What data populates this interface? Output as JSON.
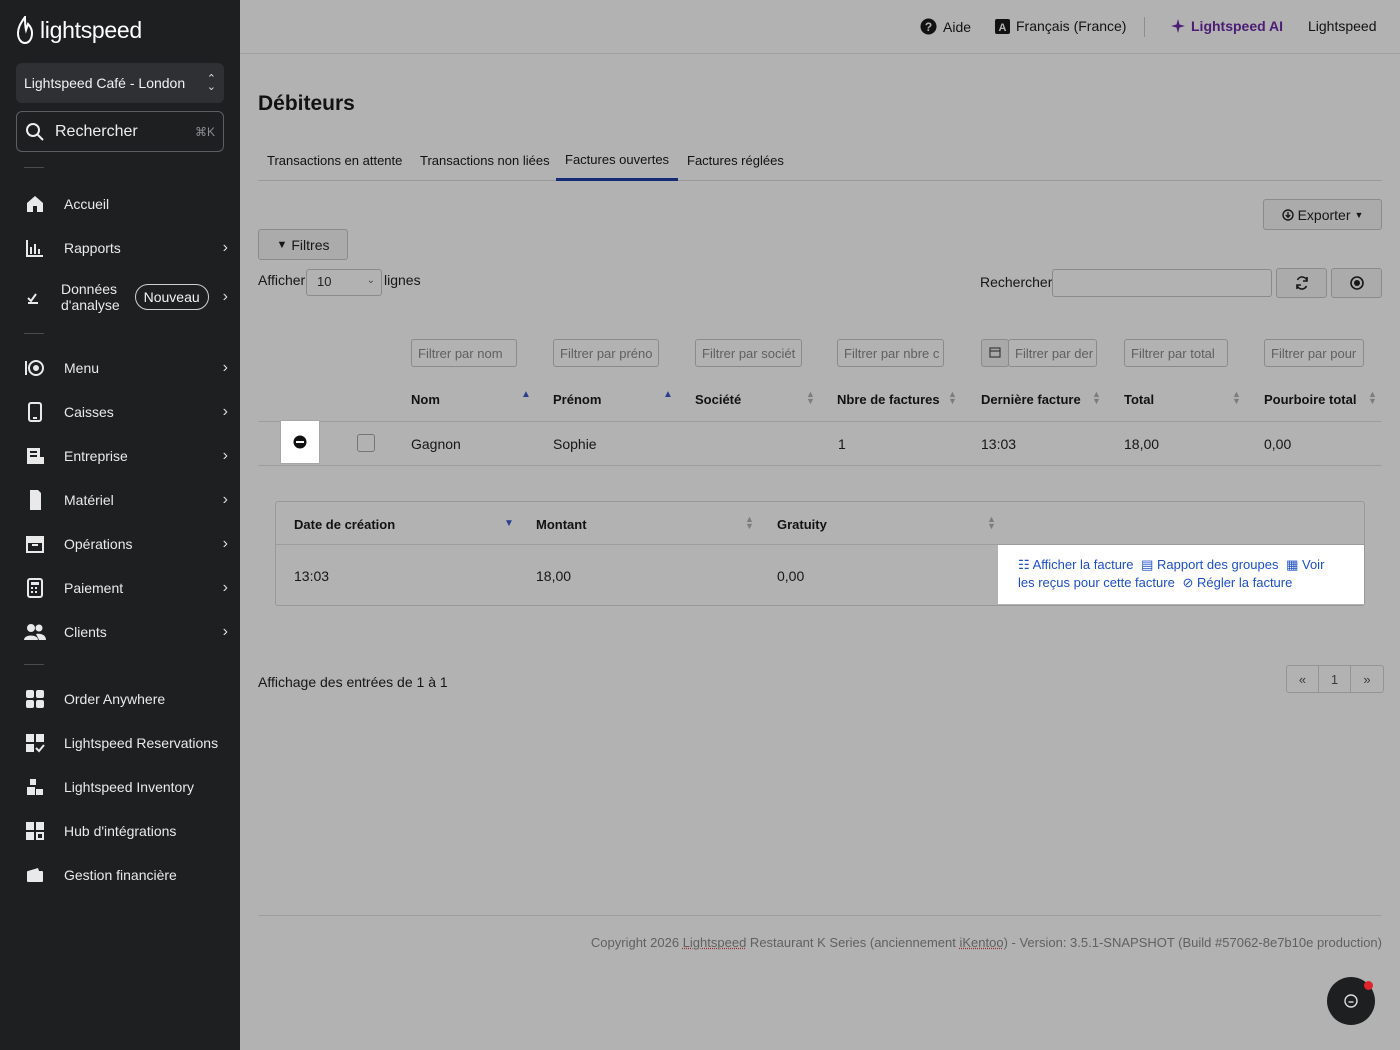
{
  "brand": {
    "logo_text": "lightspeed"
  },
  "sidebar": {
    "location": "Lightspeed Café - London",
    "search": {
      "label": "Rechercher",
      "shortcut": "⌘K"
    },
    "items": [
      {
        "label": "Accueil",
        "icon": "home-icon"
      },
      {
        "label": "Rapports",
        "icon": "bar-chart-icon"
      },
      {
        "label": "Données d'analyse",
        "icon": "analytics-icon",
        "badge": "Nouveau"
      },
      {
        "label": "Menu",
        "icon": "menu-icon"
      },
      {
        "label": "Caisses",
        "icon": "tablet-icon"
      },
      {
        "label": "Entreprise",
        "icon": "building-icon"
      },
      {
        "label": "Matériel",
        "icon": "device-icon"
      },
      {
        "label": "Opérations",
        "icon": "archive-icon"
      },
      {
        "label": "Paiement",
        "icon": "calculator-icon"
      },
      {
        "label": "Clients",
        "icon": "users-icon"
      },
      {
        "label": "Order Anywhere",
        "icon": "grid-icon"
      },
      {
        "label": "Lightspeed Reservations",
        "icon": "reservations-icon"
      },
      {
        "label": "Lightspeed Inventory",
        "icon": "inventory-icon"
      },
      {
        "label": "Hub d'intégrations",
        "icon": "integrations-icon"
      },
      {
        "label": "Gestion financière",
        "icon": "wallet-icon"
      }
    ]
  },
  "topbar": {
    "help": "Aide",
    "language": "Français (France)",
    "ai": "Lightspeed AI",
    "account": "Lightspeed"
  },
  "page": {
    "title": "Débiteurs",
    "tabs": [
      {
        "label": "Transactions en attente",
        "active": false
      },
      {
        "label": "Transactions non liées",
        "active": false
      },
      {
        "label": "Factures ouvertes",
        "active": true
      },
      {
        "label": "Factures réglées",
        "active": false
      }
    ],
    "export_label": "Exporter",
    "filters_label": "Filtres",
    "show_label": "Afficher",
    "rows_value": "10",
    "rows_suffix": "lignes",
    "search_label": "Rechercher:"
  },
  "table": {
    "filters": [
      "Filtrer par nom",
      "Filtrer par préno",
      "Filtrer par sociét",
      "Filtrer par nbre c",
      "Filtrer par der",
      "Filtrer par total",
      "Filtrer par pour"
    ],
    "columns": [
      "Nom",
      "Prénom",
      "Société",
      "Nbre de factures",
      "Dernière facture",
      "Total",
      "Pourboire total"
    ],
    "rows": [
      {
        "nom": "Gagnon",
        "prenom": "Sophie",
        "societe": "",
        "nbre": "1",
        "derniere": "13:03",
        "total": "18,00",
        "pourboire": "0,00"
      }
    ]
  },
  "sub_table": {
    "columns": [
      "Date de création",
      "Montant",
      "Gratuity"
    ],
    "rows": [
      {
        "date": "13:03",
        "montant": "18,00",
        "gratuity": "0,00"
      }
    ],
    "actions": {
      "view": "Afficher la facture",
      "group_report": "Rapport des groupes",
      "receipts": "Voir les reçus pour cette facture",
      "settle": "Régler la facture"
    }
  },
  "footer": {
    "info": "Affichage des entrées de 1 à 1",
    "pager": [
      "«",
      "1",
      "»"
    ],
    "copyright_pre": "Copyright 2026 ",
    "copyright_brand": "Lightspeed",
    "copyright_mid": " Restaurant K Series (anciennement ",
    "copyright_old": "iKentoo",
    "copyright_post": ") - Version: 3.5.1-SNAPSHOT (Build #57062-8e7b10e production)"
  },
  "colors": {
    "accent": "#1e3ea8",
    "link": "#1d4fc4",
    "ai": "#6e2aa8",
    "sidebar": "#1d1f21"
  }
}
